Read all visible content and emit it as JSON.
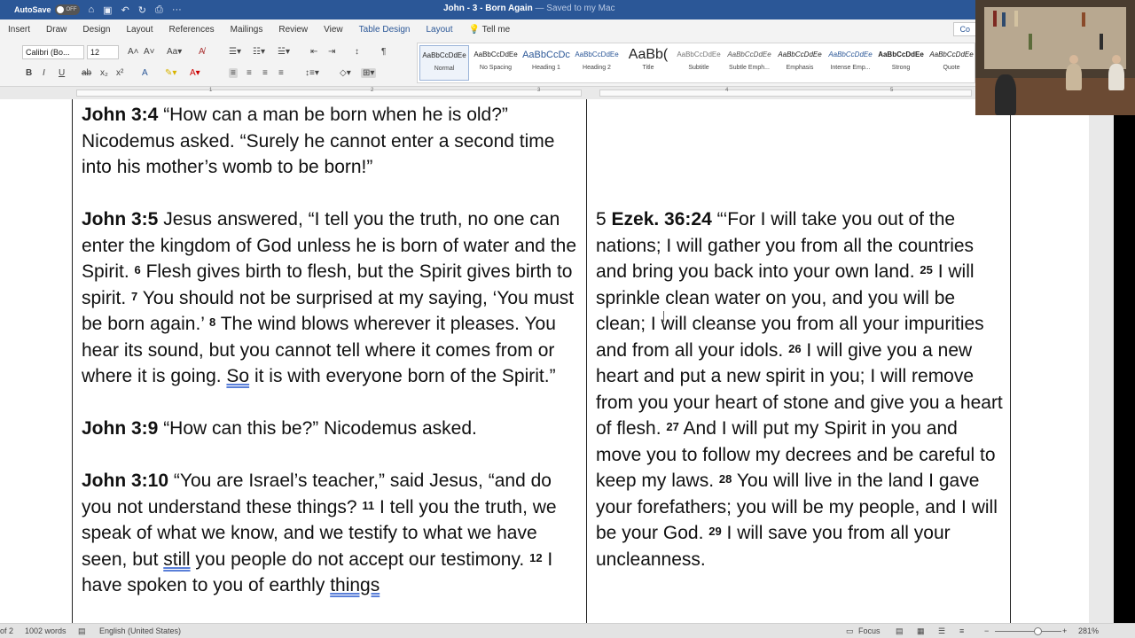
{
  "titlebar": {
    "autosave_label": "AutoSave",
    "autosave_state": "OFF",
    "doc_title": "John - 3 - Born Again",
    "saved_status": " — Saved to my Mac"
  },
  "menu": {
    "items": [
      "Insert",
      "Draw",
      "Design",
      "Layout",
      "References",
      "Mailings",
      "Review",
      "View"
    ],
    "table_design": "Table Design",
    "table_layout": "Layout",
    "tell_me": "Tell me",
    "comments": "Co"
  },
  "ribbon": {
    "font_name": "Calibri (Bo...",
    "font_size": "12",
    "styles": [
      {
        "preview": "AaBbCcDdEe",
        "name": "Normal"
      },
      {
        "preview": "AaBbCcDdEe",
        "name": "No Spacing"
      },
      {
        "preview": "AaBbCcDc",
        "name": "Heading 1"
      },
      {
        "preview": "AaBbCcDdEe",
        "name": "Heading 2"
      },
      {
        "preview": "AaBb(",
        "name": "Title"
      },
      {
        "preview": "AaBbCcDdEe",
        "name": "Subtitle"
      },
      {
        "preview": "AaBbCcDdEe",
        "name": "Subtle Emph..."
      },
      {
        "preview": "AaBbCcDdEe",
        "name": "Emphasis"
      },
      {
        "preview": "AaBbCcDdEe",
        "name": "Intense Emp..."
      },
      {
        "preview": "AaBbCcDdEe",
        "name": "Strong"
      },
      {
        "preview": "AaBbCcDdEe",
        "name": "Quote"
      }
    ]
  },
  "ruler": {
    "marks": [
      "1",
      "2",
      "3",
      "4",
      "5"
    ]
  },
  "doc": {
    "left": {
      "p1_ref": "John 3:4",
      "p1_text": "   “How can a man be born when he is old?” Nicodemus asked. “Surely he cannot enter a second time into his mother’s womb to be born!”",
      "p2_ref": "John 3:5",
      "p2_a": "   Jesus answered, “I tell you the truth, no one can enter the kingdom of God unless he is born of water and the Spirit. ",
      "p2_v6": "6",
      "p2_b": " Flesh gives birth to flesh, but the Spirit gives birth to spirit. ",
      "p2_v7": "7",
      "p2_c": " You should not be surprised at my saying, ‘You must be born again.’ ",
      "p2_v8": "8",
      "p2_d": " The wind blows wherever it pleases. You hear its sound, but you cannot tell where it comes from or where it is going. ",
      "p2_so": "So",
      "p2_e": " it is with everyone born of the Spirit.”",
      "p3_ref": "John 3:9",
      "p3_text": "   “How can this be?” Nicodemus asked.",
      "p4_ref": "John 3:10",
      "p4_a": "   “You are Israel’s teacher,” said Jesus, “and do you not understand these things? ",
      "p4_v11": "11",
      "p4_b": " I tell you the truth, we speak of what we know, and we testify to what we have seen, but ",
      "p4_still": "still",
      "p4_c": " you people do not accept our testimony. ",
      "p4_v12": "12",
      "p4_d": " I have spoken to you of earthly ",
      "p4_things": "things"
    },
    "right": {
      "lead": "5 ",
      "ref": "Ezek. 36:24",
      "a": "   “‘For I will take you out of the nations; I will gather you from all the countries and bring you back into your own land. ",
      "v25": "25",
      "b": " I will sprinkle clean water on you, and you will be clean; I will cleanse you from all your impurities and from all your idols. ",
      "v26": "26",
      "c": " I will give you a new heart and put a new spirit in you; I will remove from you your heart of stone and give you a heart of flesh. ",
      "v27": "27",
      "d": " And I will put my Spirit in you and move you to follow my decrees and be careful to keep my laws. ",
      "v28": "28",
      "e": " You will live in the land I gave your forefathers; you will be my people, and I will be your God. ",
      "v29": "29",
      "f": " I will save you from all your uncleanness."
    }
  },
  "status": {
    "page": "of 2",
    "words": "1002 words",
    "language": "English (United States)",
    "focus": "Focus",
    "zoom": "281%"
  }
}
